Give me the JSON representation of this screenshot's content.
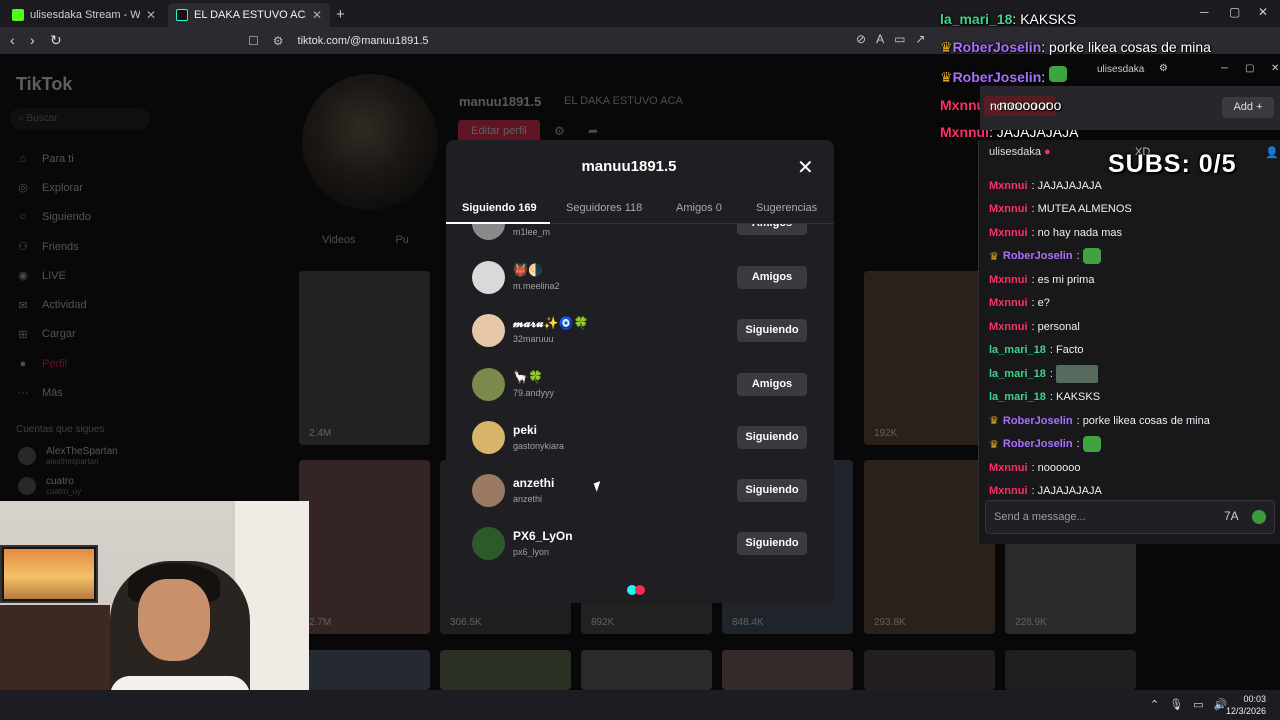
{
  "browser": {
    "tabs": [
      {
        "title": "ulisesdaka Stream - Watch Live on Ki",
        "favicon_color": "#53fc18"
      },
      {
        "title": "EL DAKA ESTUVO ACA (@manu",
        "favicon_color": "#25f4ee"
      }
    ],
    "url": "tiktok.com/@manuu1891.5"
  },
  "tiktok": {
    "logo": "TikTok",
    "search_placeholder": "Buscar",
    "nav": [
      {
        "label": "Para ti",
        "icon": "home-icon"
      },
      {
        "label": "Explorar",
        "icon": "compass-icon"
      },
      {
        "label": "Siguiendo",
        "icon": "following-icon"
      },
      {
        "label": "Friends",
        "icon": "friends-icon"
      },
      {
        "label": "LIVE",
        "icon": "live-icon"
      },
      {
        "label": "Actividad",
        "icon": "activity-icon"
      },
      {
        "label": "Cargar",
        "icon": "upload-icon"
      },
      {
        "label": "Perfil",
        "icon": "profile-icon"
      },
      {
        "label": "Más",
        "icon": "more-icon"
      }
    ],
    "following_header": "Cuentas que sigues",
    "following": [
      {
        "name": "AlexTheSpartan",
        "handle": "alexthespartan"
      },
      {
        "name": "cuatro",
        "handle": "cuatro_oy"
      }
    ],
    "profile": {
      "username": "manuu1891.5",
      "nickname": "EL DAKA ESTUVO ACA",
      "edit_label": "Editar perfil",
      "tab_videos": "Videos",
      "tab_other": "Pu"
    },
    "tiles_views": [
      "2.4M",
      "192K",
      "2.7M",
      "306.5K",
      "892K",
      "848.4K",
      "293.8K",
      "228.9K"
    ]
  },
  "modal": {
    "title": "manuu1891.5",
    "tabs": [
      {
        "label": "Siguiendo 169",
        "active": true
      },
      {
        "label": "Seguidores 118",
        "active": false
      },
      {
        "label": "Amigos 0",
        "active": false
      },
      {
        "label": "Sugerencias",
        "active": false
      }
    ],
    "users": [
      {
        "name": "",
        "handle": "m1lee_m",
        "button": "Amigos",
        "avatar": "#8a8a8a"
      },
      {
        "name": "👹🌗",
        "handle": "m.meelina2",
        "button": "Amigos",
        "avatar": "#d9d9d9"
      },
      {
        "name": "𝓶𝓪𝓻𝓾✨🧿🍀",
        "handle": "32maruuu",
        "button": "Siguiendo",
        "avatar": "#e6c7a8"
      },
      {
        "name": "🦙🍀",
        "handle": "79.andyyy",
        "button": "Amigos",
        "avatar": "#7a8a4a"
      },
      {
        "name": "peki",
        "handle": "gastonykiara",
        "button": "Siguiendo",
        "avatar": "#d8b56a"
      },
      {
        "name": "anzethi",
        "handle": "anzethi",
        "button": "Siguiendo",
        "avatar": "#9a7a62"
      },
      {
        "name": "PX6_LyOn",
        "handle": "px6_lyon",
        "button": "Siguiendo",
        "avatar": "#2b5b2b"
      }
    ]
  },
  "overlay": {
    "lines": [
      {
        "user": "la_mari_18",
        "color": "#3fd08a",
        "text": "KAKSKS",
        "crown": false
      },
      {
        "user": "RoberJoselin",
        "color": "#a970ff",
        "text": "porke likea cosas de mina",
        "crown": true
      },
      {
        "user": "RoberJoselin",
        "color": "#a970ff",
        "text": "",
        "crown": true
      },
      {
        "user": "Mxnnui",
        "color": "#ff2e63",
        "text": "nooooooo",
        "crown": false
      },
      {
        "user": "Mxnnui",
        "color": "#ff2e63",
        "text": "JAJAJAJAJA",
        "crown": false
      }
    ],
    "subs": "SUBS: 0/5"
  },
  "chat_popup": {
    "channel": "ulisesdaka",
    "pill": "noooooo",
    "add_label": "Add",
    "header": "ulisesdaka",
    "xd": "XD",
    "messages": [
      {
        "user": "Mxnnui",
        "color": "#ff2e63",
        "text": "JAJAJAJAJA",
        "crown": false,
        "emote": ""
      },
      {
        "user": "Mxnnui",
        "color": "#ff2e63",
        "text": "MUTEA ALMENOS",
        "crown": false,
        "emote": ""
      },
      {
        "user": "Mxnnui",
        "color": "#ff2e63",
        "text": "no hay nada mas",
        "crown": false,
        "emote": ""
      },
      {
        "user": "RoberJoselin",
        "color": "#a970ff",
        "text": "",
        "crown": true,
        "emote": "green"
      },
      {
        "user": "Mxnnui",
        "color": "#ff2e63",
        "text": "es mi prima",
        "crown": false,
        "emote": ""
      },
      {
        "user": "Mxnnui",
        "color": "#ff2e63",
        "text": "e?",
        "crown": false,
        "emote": ""
      },
      {
        "user": "Mxnnui",
        "color": "#ff2e63",
        "text": "personal",
        "crown": false,
        "emote": ""
      },
      {
        "user": "la_mari_18",
        "color": "#3fd08a",
        "text": "Facto",
        "crown": false,
        "emote": ""
      },
      {
        "user": "la_mari_18",
        "color": "#3fd08a",
        "text": "",
        "crown": false,
        "emote": "img"
      },
      {
        "user": "la_mari_18",
        "color": "#3fd08a",
        "text": "KAKSKS",
        "crown": false,
        "emote": ""
      },
      {
        "user": "RoberJoselin",
        "color": "#a970ff",
        "text": "porke likea cosas de mina",
        "crown": true,
        "emote": ""
      },
      {
        "user": "RoberJoselin",
        "color": "#a970ff",
        "text": "",
        "crown": true,
        "emote": "green"
      },
      {
        "user": "Mxnnui",
        "color": "#ff2e63",
        "text": "noooooo",
        "crown": false,
        "emote": ""
      },
      {
        "user": "Mxnnui",
        "color": "#ff2e63",
        "text": "JAJAJAJAJA",
        "crown": false,
        "emote": ""
      }
    ],
    "input_placeholder": "Send a message..."
  },
  "taskbar": {
    "time": "00:03",
    "date": "12/3/2026"
  }
}
